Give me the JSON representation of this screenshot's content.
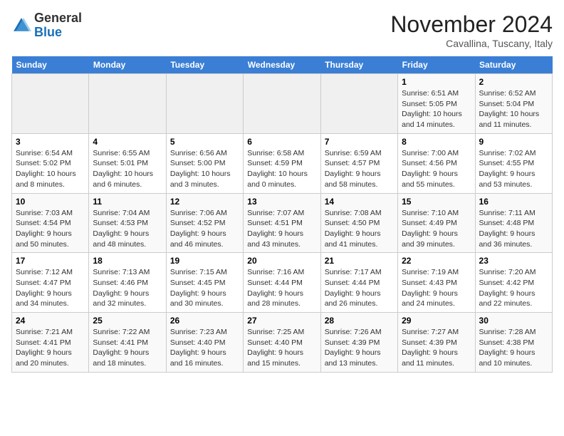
{
  "header": {
    "logo_general": "General",
    "logo_blue": "Blue",
    "month_title": "November 2024",
    "subtitle": "Cavallina, Tuscany, Italy"
  },
  "days_of_week": [
    "Sunday",
    "Monday",
    "Tuesday",
    "Wednesday",
    "Thursday",
    "Friday",
    "Saturday"
  ],
  "weeks": [
    [
      {
        "day": "",
        "info": ""
      },
      {
        "day": "",
        "info": ""
      },
      {
        "day": "",
        "info": ""
      },
      {
        "day": "",
        "info": ""
      },
      {
        "day": "",
        "info": ""
      },
      {
        "day": "1",
        "info": "Sunrise: 6:51 AM\nSunset: 5:05 PM\nDaylight: 10 hours and 14 minutes."
      },
      {
        "day": "2",
        "info": "Sunrise: 6:52 AM\nSunset: 5:04 PM\nDaylight: 10 hours and 11 minutes."
      }
    ],
    [
      {
        "day": "3",
        "info": "Sunrise: 6:54 AM\nSunset: 5:02 PM\nDaylight: 10 hours and 8 minutes."
      },
      {
        "day": "4",
        "info": "Sunrise: 6:55 AM\nSunset: 5:01 PM\nDaylight: 10 hours and 6 minutes."
      },
      {
        "day": "5",
        "info": "Sunrise: 6:56 AM\nSunset: 5:00 PM\nDaylight: 10 hours and 3 minutes."
      },
      {
        "day": "6",
        "info": "Sunrise: 6:58 AM\nSunset: 4:59 PM\nDaylight: 10 hours and 0 minutes."
      },
      {
        "day": "7",
        "info": "Sunrise: 6:59 AM\nSunset: 4:57 PM\nDaylight: 9 hours and 58 minutes."
      },
      {
        "day": "8",
        "info": "Sunrise: 7:00 AM\nSunset: 4:56 PM\nDaylight: 9 hours and 55 minutes."
      },
      {
        "day": "9",
        "info": "Sunrise: 7:02 AM\nSunset: 4:55 PM\nDaylight: 9 hours and 53 minutes."
      }
    ],
    [
      {
        "day": "10",
        "info": "Sunrise: 7:03 AM\nSunset: 4:54 PM\nDaylight: 9 hours and 50 minutes."
      },
      {
        "day": "11",
        "info": "Sunrise: 7:04 AM\nSunset: 4:53 PM\nDaylight: 9 hours and 48 minutes."
      },
      {
        "day": "12",
        "info": "Sunrise: 7:06 AM\nSunset: 4:52 PM\nDaylight: 9 hours and 46 minutes."
      },
      {
        "day": "13",
        "info": "Sunrise: 7:07 AM\nSunset: 4:51 PM\nDaylight: 9 hours and 43 minutes."
      },
      {
        "day": "14",
        "info": "Sunrise: 7:08 AM\nSunset: 4:50 PM\nDaylight: 9 hours and 41 minutes."
      },
      {
        "day": "15",
        "info": "Sunrise: 7:10 AM\nSunset: 4:49 PM\nDaylight: 9 hours and 39 minutes."
      },
      {
        "day": "16",
        "info": "Sunrise: 7:11 AM\nSunset: 4:48 PM\nDaylight: 9 hours and 36 minutes."
      }
    ],
    [
      {
        "day": "17",
        "info": "Sunrise: 7:12 AM\nSunset: 4:47 PM\nDaylight: 9 hours and 34 minutes."
      },
      {
        "day": "18",
        "info": "Sunrise: 7:13 AM\nSunset: 4:46 PM\nDaylight: 9 hours and 32 minutes."
      },
      {
        "day": "19",
        "info": "Sunrise: 7:15 AM\nSunset: 4:45 PM\nDaylight: 9 hours and 30 minutes."
      },
      {
        "day": "20",
        "info": "Sunrise: 7:16 AM\nSunset: 4:44 PM\nDaylight: 9 hours and 28 minutes."
      },
      {
        "day": "21",
        "info": "Sunrise: 7:17 AM\nSunset: 4:44 PM\nDaylight: 9 hours and 26 minutes."
      },
      {
        "day": "22",
        "info": "Sunrise: 7:19 AM\nSunset: 4:43 PM\nDaylight: 9 hours and 24 minutes."
      },
      {
        "day": "23",
        "info": "Sunrise: 7:20 AM\nSunset: 4:42 PM\nDaylight: 9 hours and 22 minutes."
      }
    ],
    [
      {
        "day": "24",
        "info": "Sunrise: 7:21 AM\nSunset: 4:41 PM\nDaylight: 9 hours and 20 minutes."
      },
      {
        "day": "25",
        "info": "Sunrise: 7:22 AM\nSunset: 4:41 PM\nDaylight: 9 hours and 18 minutes."
      },
      {
        "day": "26",
        "info": "Sunrise: 7:23 AM\nSunset: 4:40 PM\nDaylight: 9 hours and 16 minutes."
      },
      {
        "day": "27",
        "info": "Sunrise: 7:25 AM\nSunset: 4:40 PM\nDaylight: 9 hours and 15 minutes."
      },
      {
        "day": "28",
        "info": "Sunrise: 7:26 AM\nSunset: 4:39 PM\nDaylight: 9 hours and 13 minutes."
      },
      {
        "day": "29",
        "info": "Sunrise: 7:27 AM\nSunset: 4:39 PM\nDaylight: 9 hours and 11 minutes."
      },
      {
        "day": "30",
        "info": "Sunrise: 7:28 AM\nSunset: 4:38 PM\nDaylight: 9 hours and 10 minutes."
      }
    ]
  ]
}
